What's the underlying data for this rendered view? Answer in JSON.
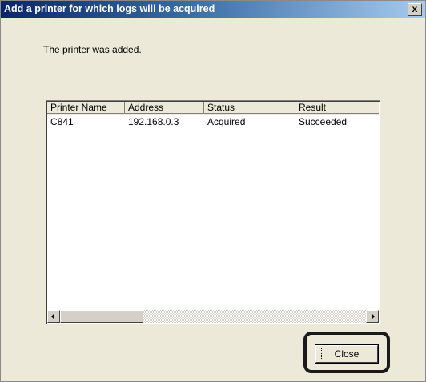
{
  "dialog": {
    "title": "Add a printer for which logs will be acquired",
    "close_glyph": "x",
    "message": "The printer was added.",
    "close_button_label": "Close"
  },
  "list": {
    "columns": [
      "Printer Name",
      "Address",
      "Status",
      "Result"
    ],
    "rows": [
      [
        "C841",
        "192.168.0.3",
        "Acquired",
        "Succeeded"
      ]
    ]
  },
  "icons": {
    "title_close": "close-icon",
    "scroll_left": "arrow-left-icon",
    "scroll_right": "arrow-right-icon"
  },
  "colors": {
    "title_start": "#0a246a",
    "title_end": "#a6caf0",
    "dialog_bg": "#ece9d8",
    "highlight": "#1a1a1a"
  }
}
